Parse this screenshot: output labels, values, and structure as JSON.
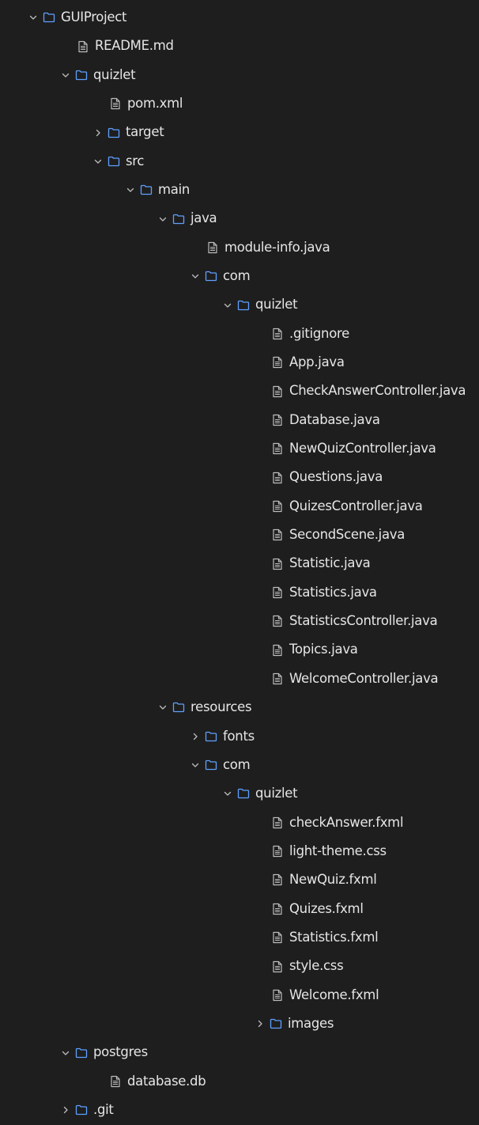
{
  "colors": {
    "background": "#1e1e1e",
    "text": "#e6e6e6",
    "chevron": "#bcbcbc",
    "folder_icon": "#5ea0ff",
    "file_icon": "#bcbcbc"
  },
  "tree": [
    {
      "label": "GUIProject",
      "kind": "folder",
      "state": "expanded",
      "depth": 0
    },
    {
      "label": "README.md",
      "kind": "file",
      "depth": 1
    },
    {
      "label": "quizlet",
      "kind": "folder",
      "state": "expanded",
      "depth": 1
    },
    {
      "label": "pom.xml",
      "kind": "file",
      "depth": 2
    },
    {
      "label": "target",
      "kind": "folder",
      "state": "collapsed",
      "depth": 2
    },
    {
      "label": "src",
      "kind": "folder",
      "state": "expanded",
      "depth": 2
    },
    {
      "label": "main",
      "kind": "folder",
      "state": "expanded",
      "depth": 3
    },
    {
      "label": "java",
      "kind": "folder",
      "state": "expanded",
      "depth": 4
    },
    {
      "label": "module-info.java",
      "kind": "file",
      "depth": 5
    },
    {
      "label": "com",
      "kind": "folder",
      "state": "expanded",
      "depth": 5
    },
    {
      "label": "quizlet",
      "kind": "folder",
      "state": "expanded",
      "depth": 6
    },
    {
      "label": ".gitignore",
      "kind": "file",
      "depth": 7
    },
    {
      "label": "App.java",
      "kind": "file",
      "depth": 7
    },
    {
      "label": "CheckAnswerController.java",
      "kind": "file",
      "depth": 7
    },
    {
      "label": "Database.java",
      "kind": "file",
      "depth": 7
    },
    {
      "label": "NewQuizController.java",
      "kind": "file",
      "depth": 7
    },
    {
      "label": "Questions.java",
      "kind": "file",
      "depth": 7
    },
    {
      "label": "QuizesController.java",
      "kind": "file",
      "depth": 7
    },
    {
      "label": "SecondScene.java",
      "kind": "file",
      "depth": 7
    },
    {
      "label": "Statistic.java",
      "kind": "file",
      "depth": 7
    },
    {
      "label": "Statistics.java",
      "kind": "file",
      "depth": 7
    },
    {
      "label": "StatisticsController.java",
      "kind": "file",
      "depth": 7
    },
    {
      "label": "Topics.java",
      "kind": "file",
      "depth": 7
    },
    {
      "label": "WelcomeController.java",
      "kind": "file",
      "depth": 7
    },
    {
      "label": "resources",
      "kind": "folder",
      "state": "expanded",
      "depth": 4
    },
    {
      "label": "fonts",
      "kind": "folder",
      "state": "collapsed",
      "depth": 5
    },
    {
      "label": "com",
      "kind": "folder",
      "state": "expanded",
      "depth": 5
    },
    {
      "label": "quizlet",
      "kind": "folder",
      "state": "expanded",
      "depth": 6
    },
    {
      "label": "checkAnswer.fxml",
      "kind": "file",
      "depth": 7
    },
    {
      "label": "light-theme.css",
      "kind": "file",
      "depth": 7
    },
    {
      "label": "NewQuiz.fxml",
      "kind": "file",
      "depth": 7
    },
    {
      "label": "Quizes.fxml",
      "kind": "file",
      "depth": 7
    },
    {
      "label": "Statistics.fxml",
      "kind": "file",
      "depth": 7
    },
    {
      "label": "style.css",
      "kind": "file",
      "depth": 7
    },
    {
      "label": "Welcome.fxml",
      "kind": "file",
      "depth": 7
    },
    {
      "label": "images",
      "kind": "folder",
      "state": "collapsed",
      "depth": 7
    },
    {
      "label": "postgres",
      "kind": "folder",
      "state": "expanded",
      "depth": 1
    },
    {
      "label": "database.db",
      "kind": "file",
      "depth": 2
    },
    {
      "label": ".git",
      "kind": "folder",
      "state": "collapsed",
      "depth": 1
    }
  ]
}
